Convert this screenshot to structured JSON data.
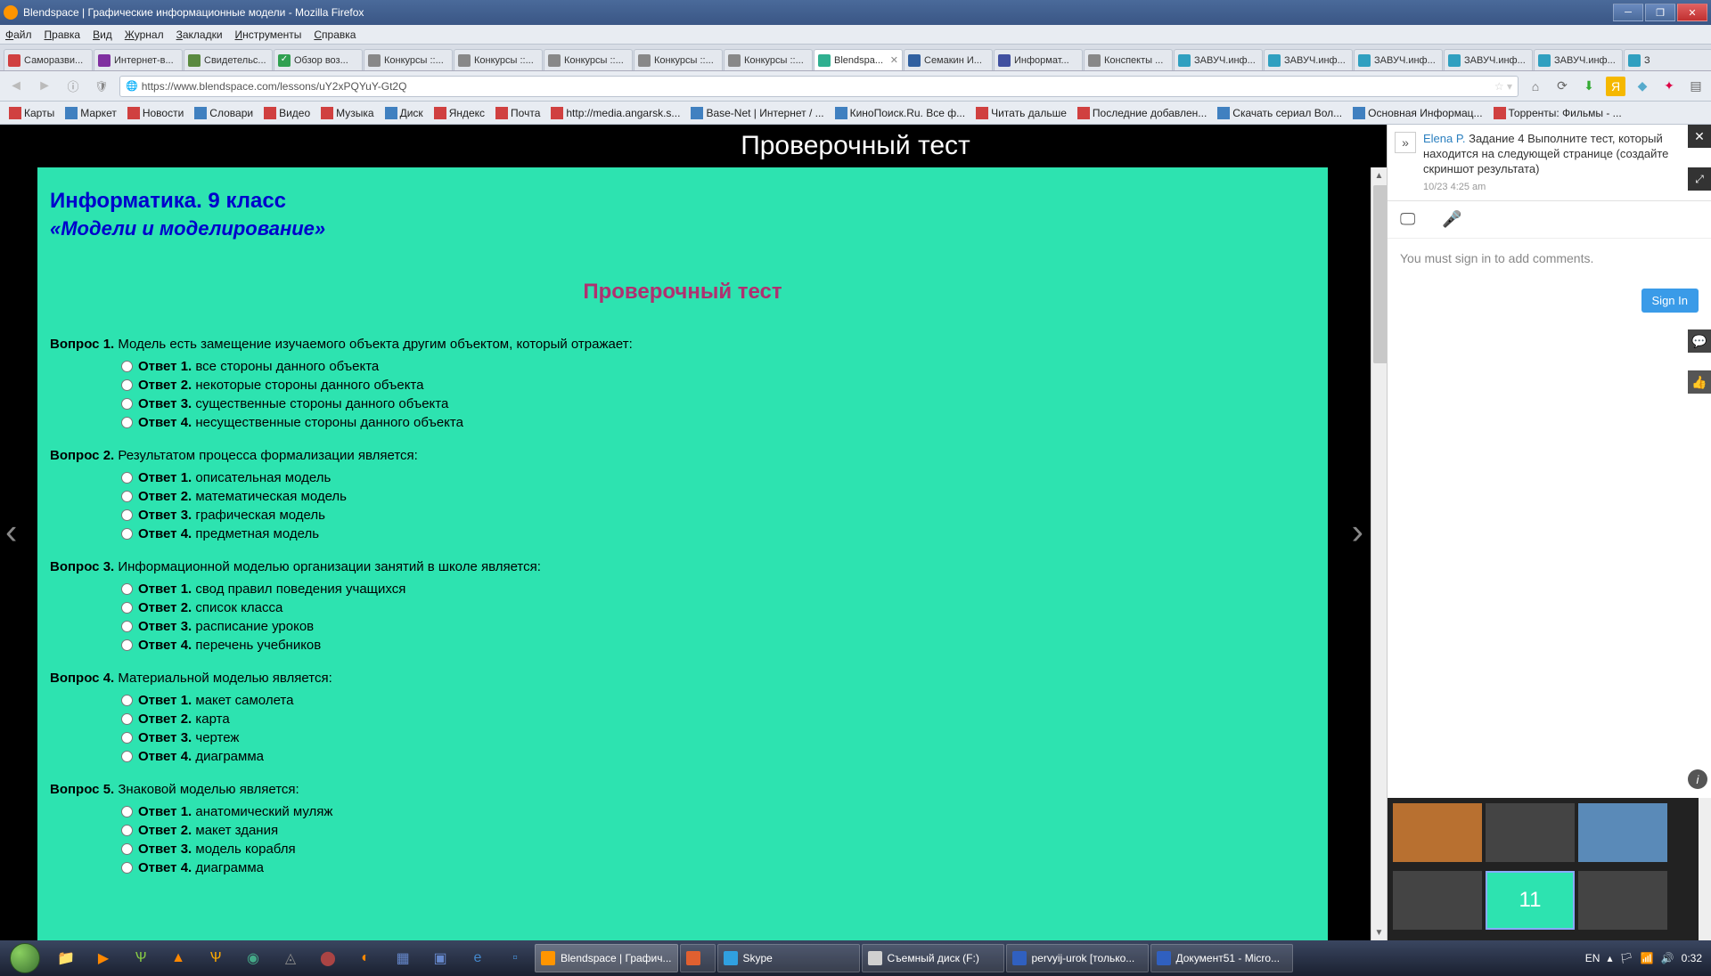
{
  "window": {
    "title": "Blendspace | Графические информационные модели - Mozilla Firefox"
  },
  "menu": [
    "Файл",
    "Правка",
    "Вид",
    "Журнал",
    "Закладки",
    "Инструменты",
    "Справка"
  ],
  "tabs": [
    {
      "label": "Саморазви...",
      "fav": "#d04040"
    },
    {
      "label": "Интернет-в...",
      "fav": "#8030a0"
    },
    {
      "label": "Свидетельс...",
      "fav": "#5a8a40"
    },
    {
      "label": "Обзор воз...",
      "fav": "#30a050",
      "check": true
    },
    {
      "label": "Конкурсы ::...",
      "fav": "#888"
    },
    {
      "label": "Конкурсы ::...",
      "fav": "#888"
    },
    {
      "label": "Конкурсы ::...",
      "fav": "#888"
    },
    {
      "label": "Конкурсы ::...",
      "fav": "#888"
    },
    {
      "label": "Конкурсы ::...",
      "fav": "#888"
    },
    {
      "label": "Blendspa...",
      "fav": "#30b090",
      "active": true
    },
    {
      "label": "Семакин И...",
      "fav": "#3060a0"
    },
    {
      "label": "Информат...",
      "fav": "#4050a0"
    },
    {
      "label": "Конспекты ...",
      "fav": "#888"
    },
    {
      "label": "ЗАВУЧ.инф...",
      "fav": "#30a0c0"
    },
    {
      "label": "ЗАВУЧ.инф...",
      "fav": "#30a0c0"
    },
    {
      "label": "ЗАВУЧ.инф...",
      "fav": "#30a0c0"
    },
    {
      "label": "ЗАВУЧ.инф...",
      "fav": "#30a0c0"
    },
    {
      "label": "ЗАВУЧ.инф...",
      "fav": "#30a0c0"
    },
    {
      "label": "З",
      "fav": "#30a0c0"
    }
  ],
  "url": "https://www.blendspace.com/lessons/uY2xPQYuY-Gt2Q",
  "bookmarks": [
    "Карты",
    "Маркет",
    "Новости",
    "Словари",
    "Видео",
    "Музыка",
    "Диск",
    "Яндекс",
    "Почта",
    "http://media.angarsk.s...",
    "Base-Net | Интернет / ...",
    "КиноПоиск.Ru. Все ф...",
    "Читать дальше",
    "Последние добавлен...",
    "Скачать сериал Вол...",
    "Основная Информац...",
    "Торренты: Фильмы - ..."
  ],
  "lesson": {
    "header": "Проверочный тест",
    "h1": "Информатика. 9 класс",
    "h2": "«Модели и моделирование»",
    "title": "Проверочный тест",
    "questions": [
      {
        "q": "Вопрос 1.",
        "text": "Модель есть замещение изучаемого объекта другим объектом, который отражает:",
        "answers": [
          "все стороны данного объекта",
          "некоторые стороны данного объекта",
          "существенные стороны данного объекта",
          "несущественные стороны данного объекта"
        ]
      },
      {
        "q": "Вопрос 2.",
        "text": "Результатом процесса формализации является:",
        "answers": [
          "описательная модель",
          "математическая модель",
          "графическая модель",
          "предметная модель"
        ]
      },
      {
        "q": "Вопрос 3.",
        "text": "Информационной моделью организации занятий в школе является:",
        "answers": [
          "свод правил поведения учащихся",
          "список класса",
          "расписание уроков",
          "перечень учебников"
        ]
      },
      {
        "q": "Вопрос 4.",
        "text": "Материальной моделью является:",
        "answers": [
          "макет самолета",
          "карта",
          "чертеж",
          "диаграмма"
        ]
      },
      {
        "q": "Вопрос 5.",
        "text": "Знаковой моделью является:",
        "answers": [
          "анатомический муляж",
          "макет здания",
          "модель корабля",
          "диаграмма"
        ]
      }
    ],
    "answer_prefix": "Ответ"
  },
  "sidebar": {
    "author": "Elena P.",
    "task": "Задание 4 Выполните тест, который находится на следующей странице (создайте скриншот результата)",
    "time": "10/23 4:25 am",
    "signin_msg": "You must sign in to add comments.",
    "signin_btn": "Sign In",
    "thumb_num": "11"
  },
  "taskbar": {
    "tasks": [
      {
        "label": "Blendspace | Графич...",
        "active": true,
        "color": "#ff9500"
      },
      {
        "label": "",
        "color": "#e06030",
        "narrow": true
      },
      {
        "label": "Skype",
        "color": "#30a0e0"
      },
      {
        "label": "Съемный диск (F:)",
        "color": "#d0d0d0"
      },
      {
        "label": "pervyij-urok [только...",
        "color": "#3060c0"
      },
      {
        "label": "Документ51 - Micro...",
        "color": "#3060c0"
      }
    ],
    "lang": "EN",
    "clock": "0:32"
  }
}
